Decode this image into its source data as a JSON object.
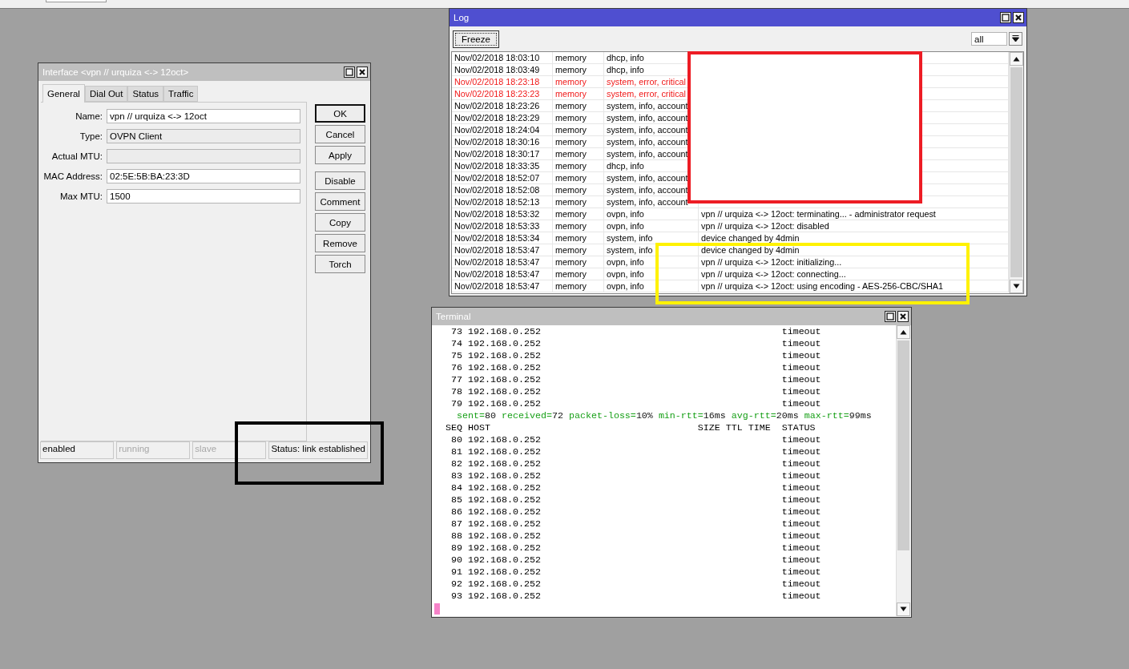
{
  "interface_window": {
    "title": "Interface <vpn // urquiza <-> 12oct>",
    "tabs": [
      {
        "label": "General",
        "selected": true
      },
      {
        "label": "Dial Out",
        "selected": false
      },
      {
        "label": "Status",
        "selected": false
      },
      {
        "label": "Traffic",
        "selected": false
      }
    ],
    "fields": [
      {
        "label": "Name:",
        "value": "vpn // urquiza <-> 12oct",
        "readonly": false
      },
      {
        "label": "Type:",
        "value": "OVPN Client",
        "readonly": true
      },
      {
        "label": "Actual MTU:",
        "readonly": true
      },
      {
        "label": "MAC Address:",
        "value": "02:5E:5B:BA:23:3D",
        "readonly": false
      },
      {
        "label": "Max MTU:",
        "value": "1500",
        "readonly": false
      }
    ],
    "button_groups": [
      [
        {
          "label": "OK",
          "default": true
        },
        {
          "label": "Cancel",
          "default": false
        },
        {
          "label": "Apply",
          "default": false
        }
      ],
      [
        {
          "label": "Disable",
          "default": false
        },
        {
          "label": "Comment",
          "default": false
        },
        {
          "label": "Copy",
          "default": false
        },
        {
          "label": "Remove",
          "default": false
        },
        {
          "label": "Torch",
          "default": false
        }
      ]
    ],
    "status_bar": [
      {
        "text": "enabled",
        "disabled": false
      },
      {
        "text": "running",
        "disabled": true
      },
      {
        "text": "slave",
        "disabled": true
      },
      {
        "text": "Status: link established",
        "disabled": false
      }
    ]
  },
  "log_window": {
    "title": "Log",
    "active": true,
    "freeze_button": "Freeze",
    "filter": "all",
    "rows": [
      {
        "time": "Nov/02/2018 18:03:10",
        "buffer": "memory",
        "topics": "dhcp, info",
        "error": false
      },
      {
        "time": "Nov/02/2018 18:03:49",
        "buffer": "memory",
        "topics": "dhcp, info",
        "error": false
      },
      {
        "time": "Nov/02/2018 18:23:18",
        "buffer": "memory",
        "topics": "system, error, critical",
        "error": true
      },
      {
        "time": "Nov/02/2018 18:23:23",
        "buffer": "memory",
        "topics": "system, error, critical",
        "error": true
      },
      {
        "time": "Nov/02/2018 18:23:26",
        "buffer": "memory",
        "topics": "system, info, account",
        "error": false
      },
      {
        "time": "Nov/02/2018 18:23:29",
        "buffer": "memory",
        "topics": "system, info, account",
        "error": false
      },
      {
        "time": "Nov/02/2018 18:24:04",
        "buffer": "memory",
        "topics": "system, info, account",
        "error": false
      },
      {
        "time": "Nov/02/2018 18:30:16",
        "buffer": "memory",
        "topics": "system, info, account",
        "error": false
      },
      {
        "time": "Nov/02/2018 18:30:17",
        "buffer": "memory",
        "topics": "system, info, account",
        "error": false
      },
      {
        "time": "Nov/02/2018 18:33:35",
        "buffer": "memory",
        "topics": "dhcp, info",
        "error": false
      },
      {
        "time": "Nov/02/2018 18:52:07",
        "buffer": "memory",
        "topics": "system, info, account",
        "error": false
      },
      {
        "time": "Nov/02/2018 18:52:08",
        "buffer": "memory",
        "topics": "system, info, account",
        "error": false
      },
      {
        "time": "Nov/02/2018 18:52:13",
        "buffer": "memory",
        "topics": "system, info, account",
        "error": false
      },
      {
        "time": "Nov/02/2018 18:53:32",
        "buffer": "memory",
        "topics": "ovpn, info",
        "message": "vpn // urquiza <-> 12oct: terminating... - administrator request",
        "error": false
      },
      {
        "time": "Nov/02/2018 18:53:33",
        "buffer": "memory",
        "topics": "ovpn, info",
        "message": "vpn // urquiza <-> 12oct: disabled",
        "error": false
      },
      {
        "time": "Nov/02/2018 18:53:34",
        "buffer": "memory",
        "topics": "system, info",
        "message": "device changed by 4dmin",
        "error": false
      },
      {
        "time": "Nov/02/2018 18:53:47",
        "buffer": "memory",
        "topics": "system, info",
        "message": "device changed by 4dmin",
        "error": false
      },
      {
        "time": "Nov/02/2018 18:53:47",
        "buffer": "memory",
        "topics": "ovpn, info",
        "message": "vpn // urquiza <-> 12oct: initializing...",
        "error": false
      },
      {
        "time": "Nov/02/2018 18:53:47",
        "buffer": "memory",
        "topics": "ovpn, info",
        "message": "vpn // urquiza <-> 12oct: connecting...",
        "error": false
      },
      {
        "time": "Nov/02/2018 18:53:47",
        "buffer": "memory",
        "topics": "ovpn, info",
        "message": "vpn // urquiza <-> 12oct: using encoding - AES-256-CBC/SHA1",
        "error": false
      }
    ]
  },
  "terminal_window": {
    "title": "Terminal",
    "lines": [
      {
        "kind": "row",
        "seq": "73",
        "host": "192.168.0.252",
        "status": "timeout"
      },
      {
        "kind": "row",
        "seq": "74",
        "host": "192.168.0.252",
        "status": "timeout"
      },
      {
        "kind": "row",
        "seq": "75",
        "host": "192.168.0.252",
        "status": "timeout"
      },
      {
        "kind": "row",
        "seq": "76",
        "host": "192.168.0.252",
        "status": "timeout"
      },
      {
        "kind": "row",
        "seq": "77",
        "host": "192.168.0.252",
        "status": "timeout"
      },
      {
        "kind": "row",
        "seq": "78",
        "host": "192.168.0.252",
        "status": "timeout"
      },
      {
        "kind": "row",
        "seq": "79",
        "host": "192.168.0.252",
        "status": "timeout"
      },
      {
        "kind": "summary",
        "pairs": [
          {
            "key": "sent=",
            "value": "80"
          },
          {
            "key": "received=",
            "value": "72"
          },
          {
            "key": "packet-loss=",
            "value": "10%"
          },
          {
            "key": "min-rtt=",
            "value": "16ms"
          },
          {
            "key": "avg-rtt=",
            "value": "20ms"
          },
          {
            "key": "max-rtt=",
            "value": "99ms"
          }
        ]
      },
      {
        "kind": "header",
        "seq": "SEQ",
        "host": "HOST",
        "size": "SIZE",
        "ttl": "TTL",
        "time": "TIME",
        "status": "STATUS"
      },
      {
        "kind": "row",
        "seq": "80",
        "host": "192.168.0.252",
        "status": "timeout"
      },
      {
        "kind": "row",
        "seq": "81",
        "host": "192.168.0.252",
        "status": "timeout"
      },
      {
        "kind": "row",
        "seq": "82",
        "host": "192.168.0.252",
        "status": "timeout"
      },
      {
        "kind": "row",
        "seq": "83",
        "host": "192.168.0.252",
        "status": "timeout"
      },
      {
        "kind": "row",
        "seq": "84",
        "host": "192.168.0.252",
        "status": "timeout"
      },
      {
        "kind": "row",
        "seq": "85",
        "host": "192.168.0.252",
        "status": "timeout"
      },
      {
        "kind": "row",
        "seq": "86",
        "host": "192.168.0.252",
        "status": "timeout"
      },
      {
        "kind": "row",
        "seq": "87",
        "host": "192.168.0.252",
        "status": "timeout"
      },
      {
        "kind": "row",
        "seq": "88",
        "host": "192.168.0.252",
        "status": "timeout"
      },
      {
        "kind": "row",
        "seq": "89",
        "host": "192.168.0.252",
        "status": "timeout"
      },
      {
        "kind": "row",
        "seq": "90",
        "host": "192.168.0.252",
        "status": "timeout"
      },
      {
        "kind": "row",
        "seq": "91",
        "host": "192.168.0.252",
        "status": "timeout"
      },
      {
        "kind": "row",
        "seq": "92",
        "host": "192.168.0.252",
        "status": "timeout"
      },
      {
        "kind": "row",
        "seq": "93",
        "host": "192.168.0.252",
        "status": "timeout"
      }
    ]
  },
  "annotations": [
    {
      "color": "#ed1c24",
      "filled": true
    },
    {
      "color": "#fff200",
      "filled": false
    },
    {
      "color": "#000000",
      "filled": false
    }
  ]
}
